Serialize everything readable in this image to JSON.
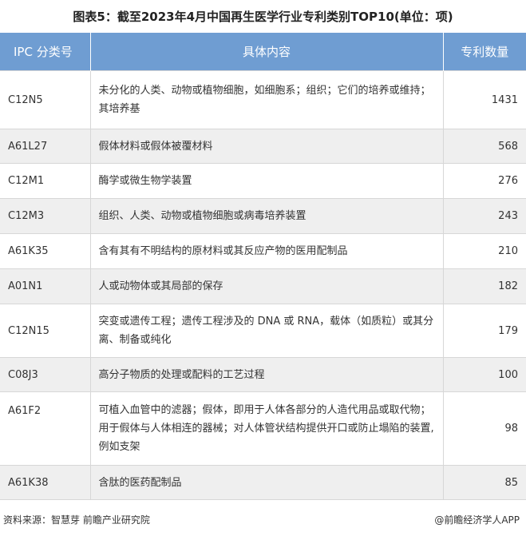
{
  "title": "图表5：截至2023年4月中国再生医学行业专利类别TOP10(单位：项)",
  "table": {
    "headers": [
      "IPC 分类号",
      "具体内容",
      "专利数量"
    ],
    "rows": [
      {
        "code": "C12N5",
        "content": "未分化的人类、动物或植物细胞，如细胞系；组织；它们的培养或维持；其培养基",
        "count": "1431"
      },
      {
        "code": "A61L27",
        "content": "假体材料或假体被覆材料",
        "count": "568"
      },
      {
        "code": "C12M1",
        "content": "酶学或微生物学装置",
        "count": "276"
      },
      {
        "code": "C12M3",
        "content": "组织、人类、动物或植物细胞或病毒培养装置",
        "count": "243"
      },
      {
        "code": "A61K35",
        "content": "含有其有不明结构的原材料或其反应产物的医用配制品",
        "count": "210"
      },
      {
        "code": "A01N1",
        "content": "人或动物体或其局部的保存",
        "count": "182"
      },
      {
        "code": "C12N15",
        "content": "突变或遗传工程；遗传工程涉及的 DNA 或 RNA，载体（如质粒）或其分离、制备或纯化",
        "count": "179"
      },
      {
        "code": "C08J3",
        "content": "高分子物质的处理或配料的工艺过程",
        "count": "100"
      },
      {
        "code": "A61F2",
        "content": "可植入血管中的滤器；假体，即用于人体各部分的人造代用品或取代物；用于假体与人体相连的器械；对人体管状结构提供开口或防止塌陷的装置,例如支架",
        "count": "98"
      },
      {
        "code": "A61K38",
        "content": "含肽的医药配制品",
        "count": "85"
      }
    ]
  },
  "footer": {
    "source": "资料来源：智慧芽 前瞻产业研究院",
    "brand": "@前瞻经济学人APP"
  }
}
